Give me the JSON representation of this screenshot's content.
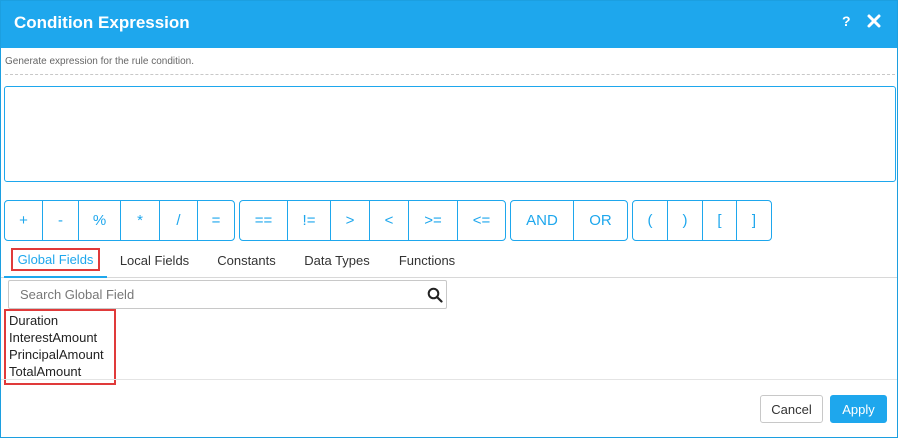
{
  "dialog": {
    "title": "Condition Expression",
    "help_label": "?",
    "subtitle": "Generate expression for the rule condition."
  },
  "operator_groups": [
    [
      "+",
      "-",
      "%",
      "*",
      "/",
      "="
    ],
    [
      "==",
      "!=",
      ">",
      "<",
      ">=",
      "<="
    ],
    [
      "AND",
      "OR"
    ],
    [
      "(",
      ")",
      "[",
      "]"
    ]
  ],
  "tabs": [
    "Global Fields",
    "Local Fields",
    "Constants",
    "Data Types",
    "Functions"
  ],
  "search": {
    "placeholder": "Search Global Field",
    "value": ""
  },
  "global_fields": [
    "Duration",
    "InterestAmount",
    "PrincipalAmount",
    "TotalAmount"
  ],
  "footer": {
    "cancel_label": "Cancel",
    "apply_label": "Apply"
  },
  "colors": {
    "accent": "#1ea7ed",
    "highlight": "#e03a3a"
  }
}
